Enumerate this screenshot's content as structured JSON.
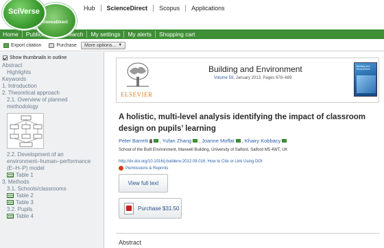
{
  "brand": {
    "primary": "SciVerse",
    "secondary": "ScienceDirect",
    "green": "#3f8f36"
  },
  "topnav": [
    "Hub",
    "ScienceDirect",
    "Scopus",
    "Applications"
  ],
  "greennav": [
    "Home",
    "Publications",
    "Search",
    "My settings",
    "My alerts",
    "Shopping cart"
  ],
  "toolbar": {
    "export": "Export citation",
    "purchase": "Purchase",
    "more": "More options..."
  },
  "sidebar": {
    "show_thumbs": "Show thumbnails in outline",
    "items": [
      {
        "label": "Abstract",
        "level": 1
      },
      {
        "label": "Highlights",
        "level": 2
      },
      {
        "label": "Keywords",
        "level": 1
      },
      {
        "label": "1. Introduction",
        "level": 1
      },
      {
        "label": "2. Theoretical approach",
        "level": 1
      },
      {
        "label": "2.1. Overview of planned methodology",
        "level": 2
      },
      {
        "label": "2.2. Development of an environment–human–performance (E–H–P) model",
        "level": 2
      },
      {
        "label": "Table 1",
        "level": 2,
        "table": true
      },
      {
        "label": "3. Methods",
        "level": 1
      },
      {
        "label": "3.1. Schools/classrooms",
        "level": 2
      },
      {
        "label": "Table 2",
        "level": 2,
        "table": true
      },
      {
        "label": "Table 3",
        "level": 2,
        "table": true
      },
      {
        "label": "3.2. Pupils",
        "level": 2
      },
      {
        "label": "Table 4",
        "level": 2,
        "table": true
      }
    ]
  },
  "journal": {
    "publisher": "ELSEVIER",
    "title": "Building and Environment",
    "volume_link": "Volume 59",
    "meta_rest": ", January 2013, Pages 678–689",
    "cover_text": "Building and Environment"
  },
  "article": {
    "title": "A holistic, multi-level analysis identifying the impact of classroom design on pupils’ learning",
    "authors": [
      "Peter Barrett",
      "Yufan Zhang",
      "Joanne Moffat",
      "Khairy Kobbacy"
    ],
    "affiliation": "School of the Built Environment, Maxwell Building, University of Salford, Salford M5 4WT, UK",
    "doi": "http://dx.doi.org/10.1016/j.buildenv.2012.09.016, How to Cite or Link Using DOI",
    "permissions": "Permissions & Reprints",
    "view_full": "View full text",
    "purchase": "Purchase $31.50",
    "abstract_heading": "Abstract"
  }
}
